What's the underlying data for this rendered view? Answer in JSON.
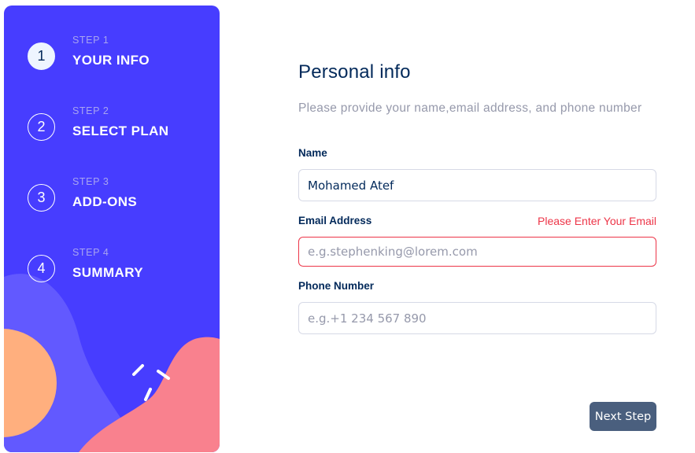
{
  "colors": {
    "sidebar_bg": "#473dff",
    "active_step_bg": "#eef5ff",
    "title": "#02295a",
    "muted_text": "#9699ab",
    "error": "#ed3548",
    "button_bg": "#4a5f7e",
    "blob_orange": "#ffaf7e",
    "blob_pink": "#f9818e",
    "blob_light_purple": "#6259ff"
  },
  "sidebar": {
    "active_index": 0,
    "steps": [
      {
        "number": "1",
        "step_label": "STEP 1",
        "title": "YOUR INFO"
      },
      {
        "number": "2",
        "step_label": "STEP 2",
        "title": "SELECT PLAN"
      },
      {
        "number": "3",
        "step_label": "STEP 3",
        "title": "ADD-ONS"
      },
      {
        "number": "4",
        "step_label": "STEP 4",
        "title": "SUMMARY"
      }
    ]
  },
  "form": {
    "title": "Personal info",
    "subtitle": "Please provide your name,email address, and phone number",
    "name": {
      "label": "Name",
      "value": "Mohamed Atef",
      "placeholder": ""
    },
    "email": {
      "label": "Email Address",
      "error": "Please Enter Your Email",
      "value": "",
      "placeholder": "e.g.stephenking@lorem.com"
    },
    "phone": {
      "label": "Phone Number",
      "value": "",
      "placeholder": "e.g.+1 234 567 890"
    },
    "next_label": "Next Step"
  }
}
